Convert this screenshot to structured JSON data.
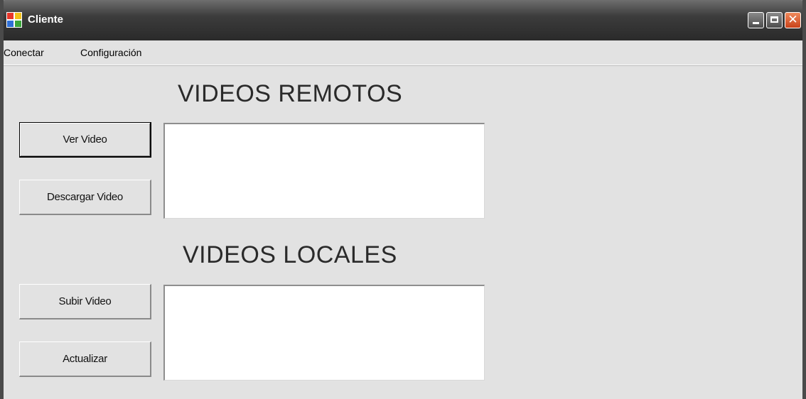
{
  "window": {
    "title": "Cliente",
    "icon": "app-window-icon",
    "controls": {
      "minimize_icon": "minimize-icon",
      "maximize_icon": "maximize-icon",
      "close_icon": "close-icon",
      "close_glyph": "✕"
    }
  },
  "menu": {
    "items": [
      {
        "label": "Conectar"
      },
      {
        "label": "Configuración"
      }
    ]
  },
  "remote": {
    "heading": "VIDEOS REMOTOS",
    "buttons": {
      "view": "Ver Video",
      "download": "Descargar Video"
    },
    "list_items": []
  },
  "local": {
    "heading": "VIDEOS LOCALES",
    "buttons": {
      "upload": "Subir Video",
      "refresh": "Actualizar"
    },
    "list_items": []
  },
  "colors": {
    "titlebar": "#3c3c3c",
    "client_area": "#e2e2e2",
    "close_button": "#d9552a"
  }
}
